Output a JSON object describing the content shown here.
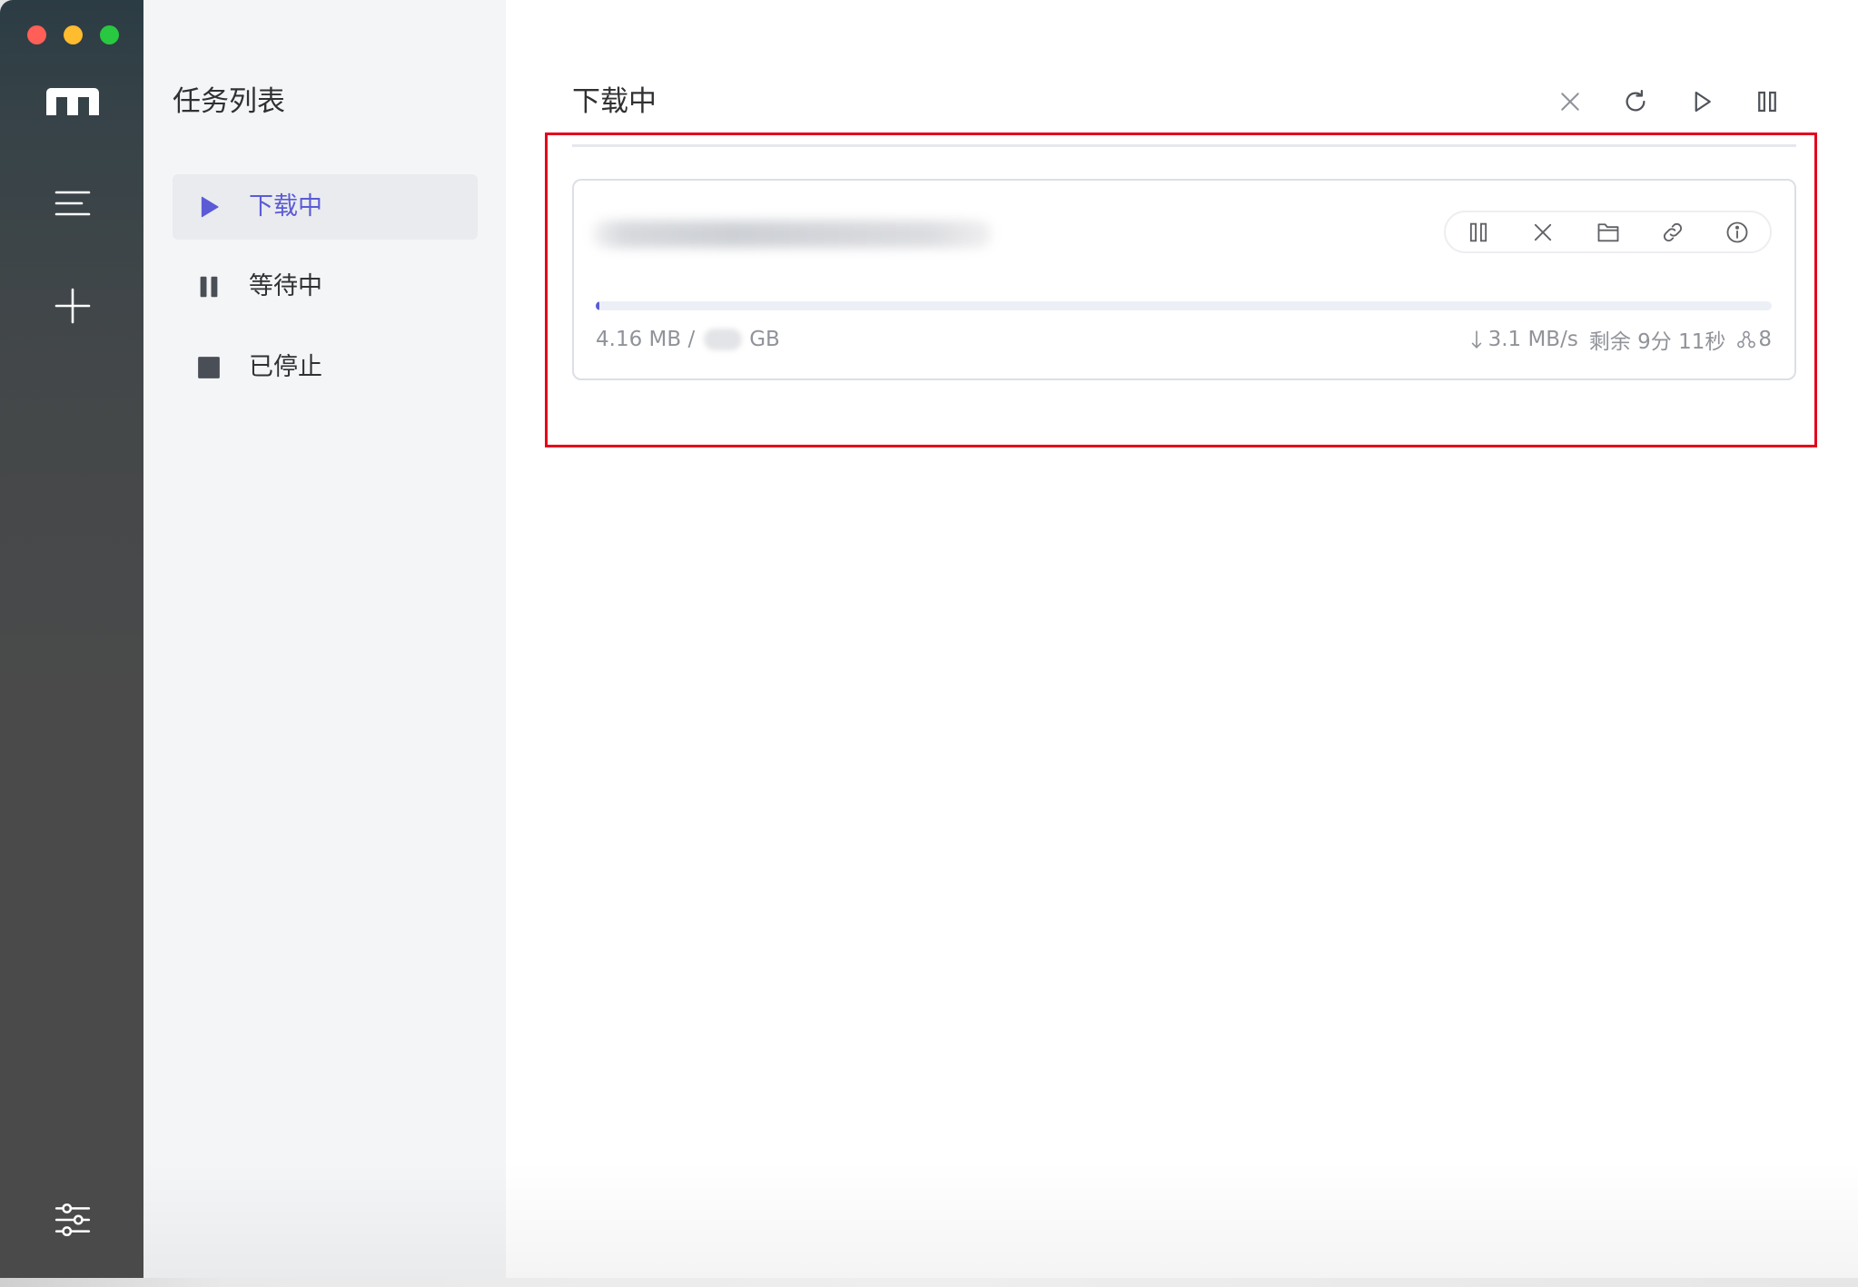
{
  "window": {
    "traffic_lights": {
      "close": "#ff5f57",
      "minimize": "#febc2e",
      "maximize": "#28c840"
    }
  },
  "colors": {
    "accent": "#5b5bd6",
    "highlight": "#e3001b"
  },
  "rail": {
    "logo_icon": "app-logo-icon",
    "nav_icons": [
      "menu-icon",
      "plus-icon"
    ],
    "footer_icon": "settings-sliders-icon"
  },
  "sidebar": {
    "title": "任务列表",
    "items": [
      {
        "label": "下载中",
        "icon": "play-icon",
        "active": true
      },
      {
        "label": "等待中",
        "icon": "pause-icon",
        "active": false
      },
      {
        "label": "已停止",
        "icon": "stop-icon",
        "active": false
      }
    ]
  },
  "main": {
    "title": "下载中",
    "toolbar_icons": [
      "close-icon",
      "refresh-icon",
      "play-icon",
      "pause-icon"
    ],
    "task": {
      "progress": 0.003,
      "completed": "4.16 MB /",
      "total_unit": "GB",
      "speed_icon": "arrow-down-icon",
      "speed": "3.1 MB/s",
      "remaining": "剩余 9分 11秒",
      "connections_icon": "connections-icon",
      "connections": "8",
      "action_icons": [
        "pause-icon",
        "close-icon",
        "folder-icon",
        "link-icon",
        "info-icon"
      ]
    }
  }
}
